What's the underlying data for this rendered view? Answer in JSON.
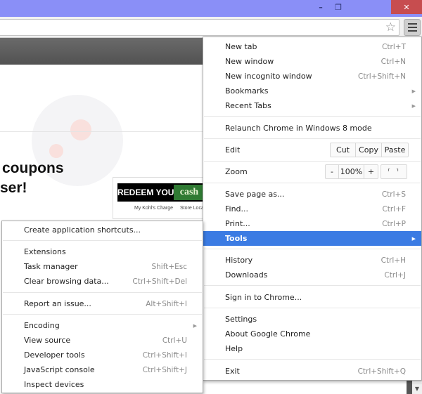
{
  "window": {
    "minimize_icon": "–",
    "maximize_icon": "❐",
    "close_icon": "✕"
  },
  "toolbar": {
    "star_icon": "☆"
  },
  "page": {
    "headline_line1": "coupons",
    "headline_line2": "ser!",
    "ad": {
      "banner_text": "REDEEM YOUR",
      "cash_text": "cash",
      "links": [
        "My Kohl's Charge",
        "Store Loca"
      ]
    }
  },
  "main_menu": {
    "items": [
      {
        "label": "New tab",
        "shortcut": "Ctrl+T"
      },
      {
        "label": "New window",
        "shortcut": "Ctrl+N"
      },
      {
        "label": "New incognito window",
        "shortcut": "Ctrl+Shift+N"
      },
      {
        "label": "Bookmarks",
        "shortcut": "",
        "submenu": true
      },
      {
        "label": "Recent Tabs",
        "shortcut": "",
        "submenu": true
      },
      {
        "label": "Relaunch Chrome in Windows 8 mode",
        "shortcut": ""
      },
      {
        "label": "Edit",
        "shortcut": ""
      },
      {
        "label": "Zoom",
        "shortcut": ""
      },
      {
        "label": "Save page as...",
        "shortcut": "Ctrl+S"
      },
      {
        "label": "Find...",
        "shortcut": "Ctrl+F"
      },
      {
        "label": "Print...",
        "shortcut": "Ctrl+P"
      },
      {
        "label": "Tools",
        "shortcut": "",
        "submenu": true,
        "highlighted": true
      },
      {
        "label": "History",
        "shortcut": "Ctrl+H"
      },
      {
        "label": "Downloads",
        "shortcut": "Ctrl+J"
      },
      {
        "label": "Sign in to Chrome...",
        "shortcut": ""
      },
      {
        "label": "Settings",
        "shortcut": ""
      },
      {
        "label": "About Google Chrome",
        "shortcut": ""
      },
      {
        "label": "Help",
        "shortcut": ""
      },
      {
        "label": "Exit",
        "shortcut": "Ctrl+Shift+Q"
      }
    ],
    "edit": {
      "cut": "Cut",
      "copy": "Copy",
      "paste": "Paste"
    },
    "zoom": {
      "minus": "-",
      "level": "100%",
      "plus": "+",
      "fullscreen": "⸢ ⸣"
    },
    "submenu_arrow": "▶"
  },
  "tools_submenu": {
    "items": [
      {
        "label": "Create application shortcuts...",
        "shortcut": ""
      },
      {
        "label": "Extensions",
        "shortcut": ""
      },
      {
        "label": "Task manager",
        "shortcut": "Shift+Esc"
      },
      {
        "label": "Clear browsing data...",
        "shortcut": "Ctrl+Shift+Del"
      },
      {
        "label": "Report an issue...",
        "shortcut": "Alt+Shift+I"
      },
      {
        "label": "Encoding",
        "shortcut": "",
        "submenu": true
      },
      {
        "label": "View source",
        "shortcut": "Ctrl+U"
      },
      {
        "label": "Developer tools",
        "shortcut": "Ctrl+Shift+I"
      },
      {
        "label": "JavaScript console",
        "shortcut": "Ctrl+Shift+J"
      },
      {
        "label": "Inspect devices",
        "shortcut": ""
      }
    ]
  },
  "scrollbar": {
    "down_arrow": "▼"
  }
}
